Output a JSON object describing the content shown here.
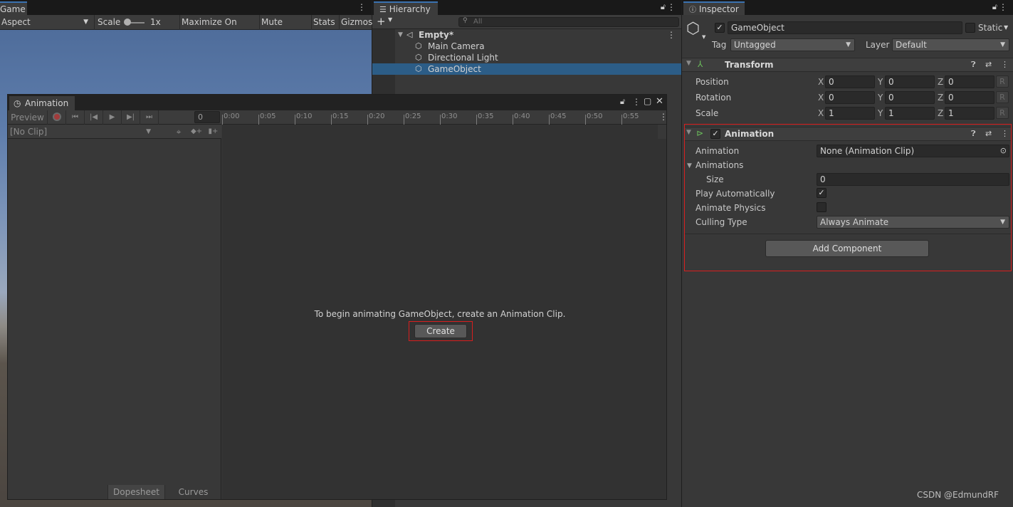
{
  "game": {
    "tab": "Game",
    "aspect": "Aspect",
    "scale_label": "Scale",
    "scale_value": "1x",
    "maximize": "Maximize On Play",
    "mute": "Mute Audio",
    "stats": "Stats",
    "gizmos": "Gizmos"
  },
  "hierarchy": {
    "tab": "Hierarchy",
    "search_placeholder": "All",
    "scene": "Empty*",
    "items": [
      "Main Camera",
      "Directional Light",
      "GameObject"
    ]
  },
  "inspector": {
    "tab": "Inspector",
    "object_name": "GameObject",
    "static_label": "Static",
    "tag_label": "Tag",
    "tag_value": "Untagged",
    "layer_label": "Layer",
    "layer_value": "Default",
    "transform": {
      "title": "Transform",
      "rows": [
        {
          "label": "Position",
          "x": "0",
          "y": "0",
          "z": "0"
        },
        {
          "label": "Rotation",
          "x": "0",
          "y": "0",
          "z": "0"
        },
        {
          "label": "Scale",
          "x": "1",
          "y": "1",
          "z": "1"
        }
      ],
      "axis_x": "X",
      "axis_y": "Y",
      "axis_z": "Z",
      "reset": "R"
    },
    "animation": {
      "title": "Animation",
      "animation_label": "Animation",
      "animation_value": "None (Animation Clip)",
      "animations_label": "Animations",
      "size_label": "Size",
      "size_value": "0",
      "play_auto_label": "Play Automatically",
      "physics_label": "Animate Physics",
      "culling_label": "Culling Type",
      "culling_value": "Always Animate"
    },
    "add_component": "Add Component"
  },
  "animation_window": {
    "tab": "Animation",
    "preview": "Preview",
    "frame": "0",
    "clip": "[No Clip]",
    "ticks": [
      "0:00",
      "0:05",
      "0:10",
      "0:15",
      "0:20",
      "0:25",
      "0:30",
      "0:35",
      "0:40",
      "0:45",
      "0:50",
      "0:55"
    ],
    "message": "To begin animating GameObject, create an Animation Clip.",
    "create": "Create",
    "dopesheet": "Dopesheet",
    "curves": "Curves"
  },
  "watermark": "CSDN @EdmundRF",
  "colors": {
    "selection": "#2c5d87",
    "highlight_box": "#d81e1e",
    "tab_accent": "#3a72b0"
  }
}
